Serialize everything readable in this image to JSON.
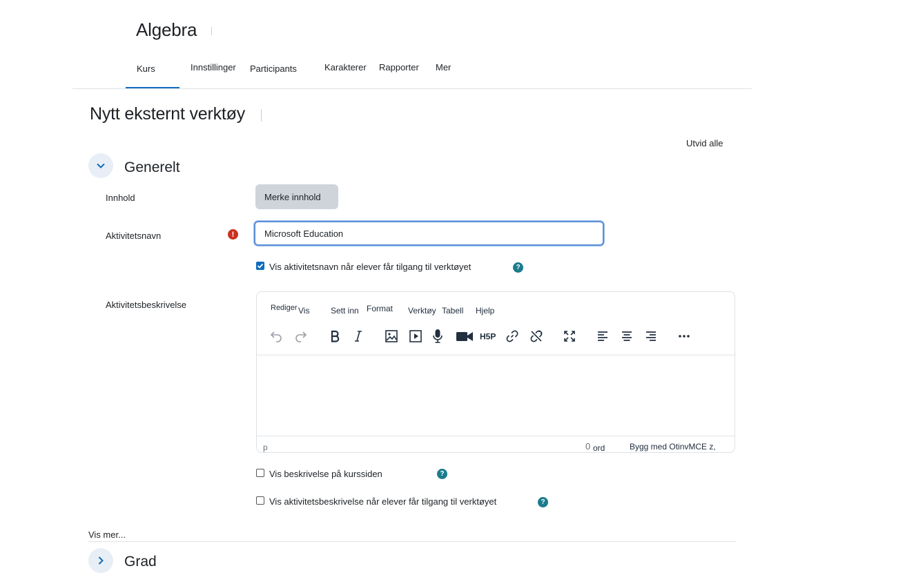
{
  "course": {
    "title": "Algebra"
  },
  "nav": {
    "items": [
      {
        "label": "Kurs"
      },
      {
        "label": "Innstillinger"
      },
      {
        "label": "Participants"
      },
      {
        "label": "Karakterer"
      },
      {
        "label": "Rapporter"
      },
      {
        "label": "Mer"
      }
    ]
  },
  "page": {
    "heading": "Nytt eksternt verktøy",
    "expand_all": "Utvid alle"
  },
  "general": {
    "title": "Generelt",
    "content_label": "Innhold",
    "select_content_button": "Merke innhold",
    "activity_name_label": "Aktivitetsnavn",
    "activity_name_value": "Microsoft Education",
    "show_name_checkbox": "Vis aktivitetsnavn når elever får tilgang til verktøyet",
    "description_label": "Aktivitetsbeskrivelse",
    "show_desc_course_checkbox": "Vis beskrivelse på kurssiden",
    "show_desc_tool_checkbox": "Vis aktivitetsbeskrivelse når elever får tilgang til verktøyet"
  },
  "editor": {
    "menus": [
      "Rediger",
      "Vis",
      "Sett inn",
      "Format",
      "Verktøy",
      "Tabell",
      "Hjelp"
    ],
    "toolbar_icons": [
      "undo-icon",
      "redo-icon",
      "bold-icon",
      "italic-icon",
      "image-icon",
      "media-icon",
      "microphone-icon",
      "video-camera-icon",
      "h5p-icon",
      "link-icon",
      "unlink-icon",
      "fullscreen-icon",
      "align-left-icon",
      "align-center-icon",
      "align-right-icon",
      "more-icon"
    ],
    "h5p_text": "H5P",
    "status_path": "p",
    "word_count": "0",
    "word_unit": "ord",
    "branding": "Bygg med OtinvMCE z,"
  },
  "footer": {
    "show_more": "Vis mer...",
    "grade_section_title": "Grad"
  },
  "colors": {
    "accent": "#0f6cbf",
    "error": "#ca3120",
    "help": "#1b7c8c",
    "collapse_bg": "#e8eef6"
  }
}
